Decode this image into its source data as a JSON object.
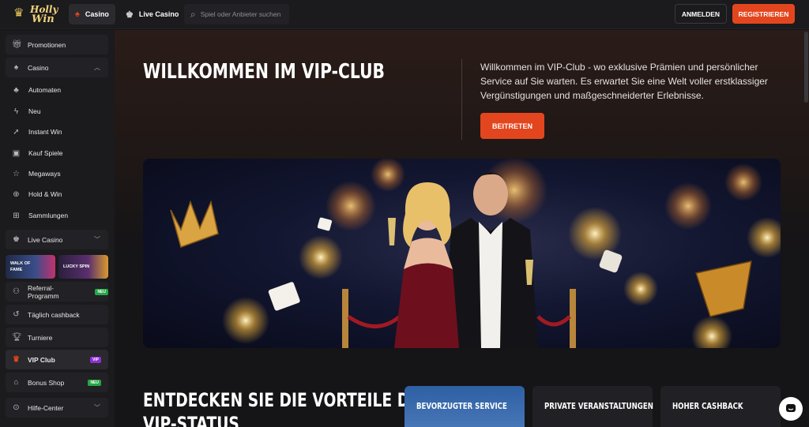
{
  "header": {
    "logo_line1": "Holly",
    "logo_line2": "Win",
    "tabs": [
      {
        "label": "Casino",
        "icon": "spade-icon"
      },
      {
        "label": "Live Casino",
        "icon": "dealer-icon"
      }
    ],
    "search_placeholder": "Spiel oder Anbieter suchen",
    "login_label": "ANMELDEN",
    "register_label": "REGISTRIEREN"
  },
  "sidebar": {
    "promotionen": "Promotionen",
    "casino": "Casino",
    "casino_items": [
      {
        "label": "Automaten",
        "icon": "slots-icon"
      },
      {
        "label": "Neu",
        "icon": "lightning-icon"
      },
      {
        "label": "Instant Win",
        "icon": "rocket-icon"
      },
      {
        "label": "Kauf Spiele",
        "icon": "gift-icon"
      },
      {
        "label": "Megaways",
        "icon": "star-icon"
      },
      {
        "label": "Hold & Win",
        "icon": "hold-icon"
      },
      {
        "label": "Sammlungen",
        "icon": "grid-icon"
      }
    ],
    "live_casino": "Live Casino",
    "promo_cards": [
      {
        "label": "WALK OF FAME"
      },
      {
        "label": "LUCKY SPIN"
      }
    ],
    "referral": "Referral-Programm",
    "referral_badge": "NEU",
    "cashback": "Täglich cashback",
    "turniere": "Turniere",
    "vip_club": "VIP Club",
    "vip_badge": "VIP",
    "bonus_shop": "Bonus Shop",
    "bonus_badge": "NEU",
    "hilfe": "Hilfe-Center"
  },
  "hero": {
    "title": "WILLKOMMEN IM VIP-CLUB",
    "text": "Willkommen im VIP-Club - wo exklusive Prämien und persönlicher Service auf Sie warten. Es erwartet Sie eine Welt voller erstklassiger Vergünstigungen und maßgeschneiderter Erlebnisse.",
    "join_label": "BEITRETEN"
  },
  "benefits": {
    "title": "ENTDECKEN SIE DIE VORTEILE DES VIP-STATUS",
    "cards": [
      {
        "label": "BEVORZUGTER SERVICE"
      },
      {
        "label": "PRIVATE VERANSTALTUNGEN"
      },
      {
        "label": "HOHER CASHBACK"
      }
    ]
  },
  "colors": {
    "accent": "#e3461e",
    "vip_badge": "#8e2fd6",
    "new_badge": "#25a746"
  }
}
